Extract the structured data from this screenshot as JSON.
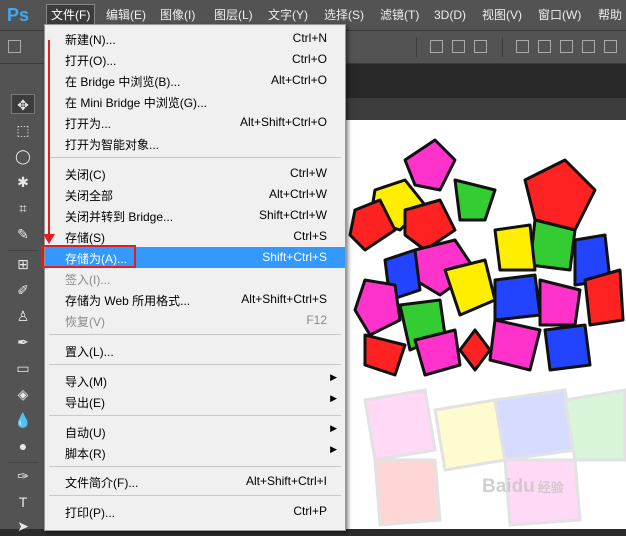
{
  "app": {
    "logo": "Ps"
  },
  "menubar": [
    {
      "label": "文件(F)",
      "active": true
    },
    {
      "label": "编辑(E)"
    },
    {
      "label": "图像(I)"
    },
    {
      "label": "图层(L)"
    },
    {
      "label": "文字(Y)"
    },
    {
      "label": "选择(S)"
    },
    {
      "label": "滤镜(T)"
    },
    {
      "label": "3D(D)"
    },
    {
      "label": "视图(V)"
    },
    {
      "label": "窗口(W)"
    },
    {
      "label": "帮助"
    }
  ],
  "file_menu": {
    "items": [
      {
        "label": "新建(N)...",
        "shortcut": "Ctrl+N"
      },
      {
        "label": "打开(O)...",
        "shortcut": "Ctrl+O"
      },
      {
        "label": "在 Bridge 中浏览(B)...",
        "shortcut": "Alt+Ctrl+O"
      },
      {
        "label": "在 Mini Bridge 中浏览(G)...",
        "shortcut": ""
      },
      {
        "label": "打开为...",
        "shortcut": "Alt+Shift+Ctrl+O"
      },
      {
        "label": "打开为智能对象...",
        "shortcut": ""
      },
      {
        "label": "关闭(C)",
        "shortcut": "Ctrl+W"
      },
      {
        "label": "关闭全部",
        "shortcut": "Alt+Ctrl+W"
      },
      {
        "label": "关闭并转到 Bridge...",
        "shortcut": "Shift+Ctrl+W"
      },
      {
        "label": "存储(S)",
        "shortcut": "Ctrl+S"
      },
      {
        "label": "存储为(A)...",
        "shortcut": "Shift+Ctrl+S",
        "highlighted": true
      },
      {
        "label": "签入(I)...",
        "shortcut": "",
        "disabled": true
      },
      {
        "label": "存储为 Web 所用格式...",
        "shortcut": "Alt+Shift+Ctrl+S"
      },
      {
        "label": "恢复(V)",
        "shortcut": "F12",
        "disabled": true
      },
      {
        "label": "置入(L)...",
        "shortcut": ""
      },
      {
        "label": "导入(M)",
        "shortcut": "",
        "submenu": true
      },
      {
        "label": "导出(E)",
        "shortcut": "",
        "submenu": true
      },
      {
        "label": "自动(U)",
        "shortcut": "",
        "submenu": true
      },
      {
        "label": "脚本(R)",
        "shortcut": "",
        "submenu": true
      },
      {
        "label": "文件简介(F)...",
        "shortcut": "Alt+Shift+Ctrl+I"
      },
      {
        "label": "打印(P)...",
        "shortcut": "Ctrl+P"
      }
    ]
  },
  "tools": [
    "move-tool",
    "marquee-tool",
    "lasso-tool",
    "magic-wand-tool",
    "crop-tool",
    "eyedropper-tool",
    "healing-brush-tool",
    "brush-tool",
    "clone-stamp-tool",
    "history-brush-tool",
    "eraser-tool",
    "paint-bucket-tool",
    "blur-tool",
    "dodge-tool",
    "pen-tool",
    "type-tool",
    "path-select-tool"
  ],
  "watermark": {
    "brand": "Baidu",
    "suffix": "经验"
  },
  "colors": {
    "highlight": "#3399ff",
    "annotation": "#e02020"
  }
}
